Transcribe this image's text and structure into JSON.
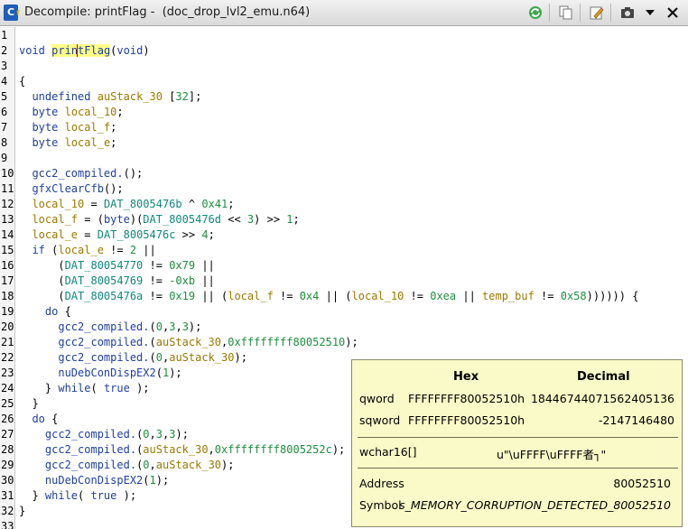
{
  "window": {
    "title": "Decompile: printFlag -  (doc_drop_lvl2_emu.n64)",
    "icon": "ghidra-decompiler-icon",
    "toolbar": [
      "refresh-icon",
      "copy-icon",
      "edit-icon",
      "snapshot-icon",
      "dropdown-icon",
      "close-icon"
    ]
  },
  "code_lines": [
    {
      "n": "1",
      "t": ""
    },
    {
      "n": "2",
      "t": "void printFlag(void)"
    },
    {
      "n": "3",
      "t": ""
    },
    {
      "n": "4",
      "t": "{"
    },
    {
      "n": "5",
      "t": "  undefined auStack_30 [32];"
    },
    {
      "n": "6",
      "t": "  byte local_10;"
    },
    {
      "n": "7",
      "t": "  byte local_f;"
    },
    {
      "n": "8",
      "t": "  byte local_e;"
    },
    {
      "n": "9",
      "t": ""
    },
    {
      "n": "10",
      "t": "  gcc2_compiled.();"
    },
    {
      "n": "11",
      "t": "  gfxClearCfb();"
    },
    {
      "n": "12",
      "t": "  local_10 = DAT_8005476b ^ 0x41;"
    },
    {
      "n": "13",
      "t": "  local_f = (byte)(DAT_8005476d << 3) >> 1;"
    },
    {
      "n": "14",
      "t": "  local_e = DAT_8005476c >> 4;"
    },
    {
      "n": "15",
      "t": "  if (local_e != 2 ||"
    },
    {
      "n": "16",
      "t": "      (DAT_80054770 != 0x79 ||"
    },
    {
      "n": "17",
      "t": "      (DAT_80054769 != -0xb ||"
    },
    {
      "n": "18",
      "t": "      (DAT_8005476a != 0x19 || (local_f != 0x4 || (local_10 != 0xea || temp_buf != 0x58)))))) {"
    },
    {
      "n": "19",
      "t": "    do {"
    },
    {
      "n": "20",
      "t": "      gcc2_compiled.(0,3,3);"
    },
    {
      "n": "21",
      "t": "      gcc2_compiled.(auStack_30,0xffffffff80052510);"
    },
    {
      "n": "22",
      "t": "      gcc2_compiled.(0,auStack_30);"
    },
    {
      "n": "23",
      "t": "      nuDebConDispEX2(1);"
    },
    {
      "n": "24",
      "t": "    } while( true );"
    },
    {
      "n": "25",
      "t": "  }"
    },
    {
      "n": "26",
      "t": "  do {"
    },
    {
      "n": "27",
      "t": "    gcc2_compiled.(0,3,3);"
    },
    {
      "n": "28",
      "t": "    gcc2_compiled.(auStack_30,0xffffffff8005252c);"
    },
    {
      "n": "29",
      "t": "    gcc2_compiled.(0,auStack_30);"
    },
    {
      "n": "30",
      "t": "    nuDebConDispEX2(1);"
    },
    {
      "n": "31",
      "t": "  } while( true );"
    },
    {
      "n": "32",
      "t": "}"
    },
    {
      "n": "33",
      "t": ""
    }
  ],
  "tooltip": {
    "hex_header": "Hex",
    "dec_header": "Decimal",
    "qword_label": "qword",
    "qword_hex": "FFFFFFFF80052510h",
    "qword_dec": "18446744071562405136",
    "sqword_label": "sqword",
    "sqword_hex": "FFFFFFFF80052510h",
    "sqword_dec": "-2147146480",
    "wchar_label": "wchar16[]",
    "wchar_value": "u\"\\uFFFF\\uFFFF者┐\"",
    "address_label": "Address",
    "address_value": "80052510",
    "symbol_label": "Symbol",
    "symbol_value": "s_MEMORY_CORRUPTION_DETECTED_80052510"
  },
  "colors": {
    "function": "#1f3f9f",
    "variable": "#9a7a00",
    "number": "#1e8f3e",
    "global": "#10887a",
    "tooltip_bg": "#fafac8",
    "highlight": "#ffff88",
    "cursor": "#e00000"
  }
}
